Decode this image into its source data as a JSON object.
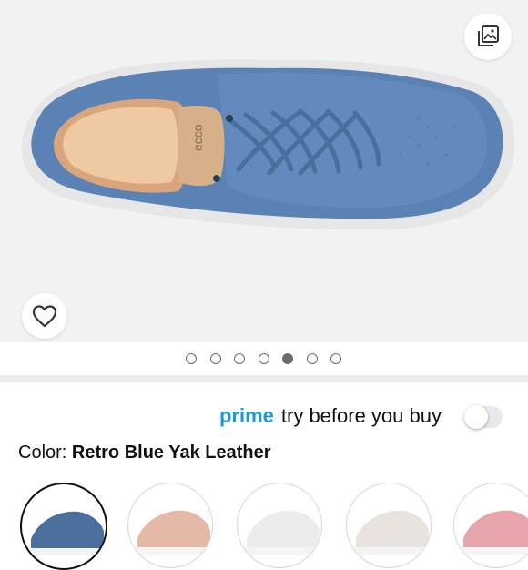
{
  "gallery": {
    "image_count": 7,
    "active_index": 4
  },
  "prime_try": {
    "brand": "prime",
    "text": "try before you buy",
    "toggle_on": false
  },
  "color": {
    "label": "Color:",
    "selected": "Retro Blue Yak Leather"
  },
  "swatches": [
    {
      "color": "#4a6f9c",
      "selected": true
    },
    {
      "color": "#e6b8a8",
      "selected": false
    },
    {
      "color": "#ececec",
      "selected": false
    },
    {
      "color": "#e8e3df",
      "selected": false
    },
    {
      "color": "#e7a4ac",
      "selected": false
    }
  ],
  "icons": {
    "gallery": "gallery-icon",
    "wishlist": "heart-icon"
  }
}
